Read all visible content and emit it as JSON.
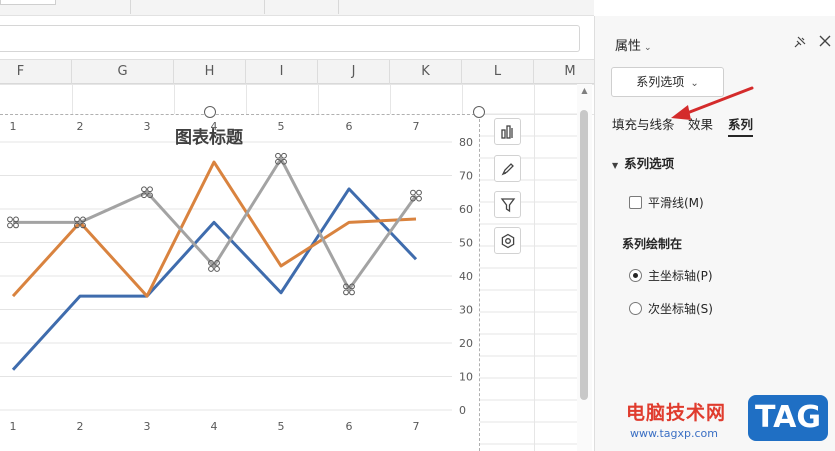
{
  "columns": [
    "F",
    "G",
    "H",
    "I",
    "J",
    "K",
    "L",
    "M"
  ],
  "chart_data": {
    "type": "line",
    "title": "图表标题",
    "categories": [
      "1",
      "2",
      "3",
      "4",
      "5",
      "6",
      "7"
    ],
    "ylim": [
      0,
      80
    ],
    "yticks": [
      "0",
      "10",
      "20",
      "30",
      "40",
      "50",
      "60",
      "70",
      "80"
    ],
    "series": [
      {
        "values": [
          12,
          34,
          34,
          56,
          35,
          66,
          45
        ],
        "color": "#3f6cad"
      },
      {
        "values": [
          34,
          56,
          34,
          74,
          43,
          56,
          57
        ],
        "color": "#d9833f"
      },
      {
        "values": [
          56,
          56,
          65,
          43,
          75,
          36,
          64
        ],
        "color": "#a3a3a3"
      }
    ],
    "grid": true
  },
  "chart_tools": {
    "icons": [
      "chart-elements-icon",
      "chart-style-icon",
      "chart-filter-icon",
      "chart-settings-icon"
    ]
  },
  "panel": {
    "title": "属性",
    "dropdown": "系列选项",
    "tabs": [
      "填充与线条",
      "效果",
      "系列"
    ],
    "active_tab": "系列",
    "section": "系列选项",
    "smooth_line": "平滑线(M)",
    "plot_on": "系列绘制在",
    "primary_axis": "主坐标轴(P)",
    "secondary_axis": "次坐标轴(S)"
  },
  "watermark": {
    "site": "电脑技术网",
    "url": "www.tagxp.com",
    "tag": "TAG"
  },
  "colors": {
    "accent_arrow": "#d42b2b"
  }
}
